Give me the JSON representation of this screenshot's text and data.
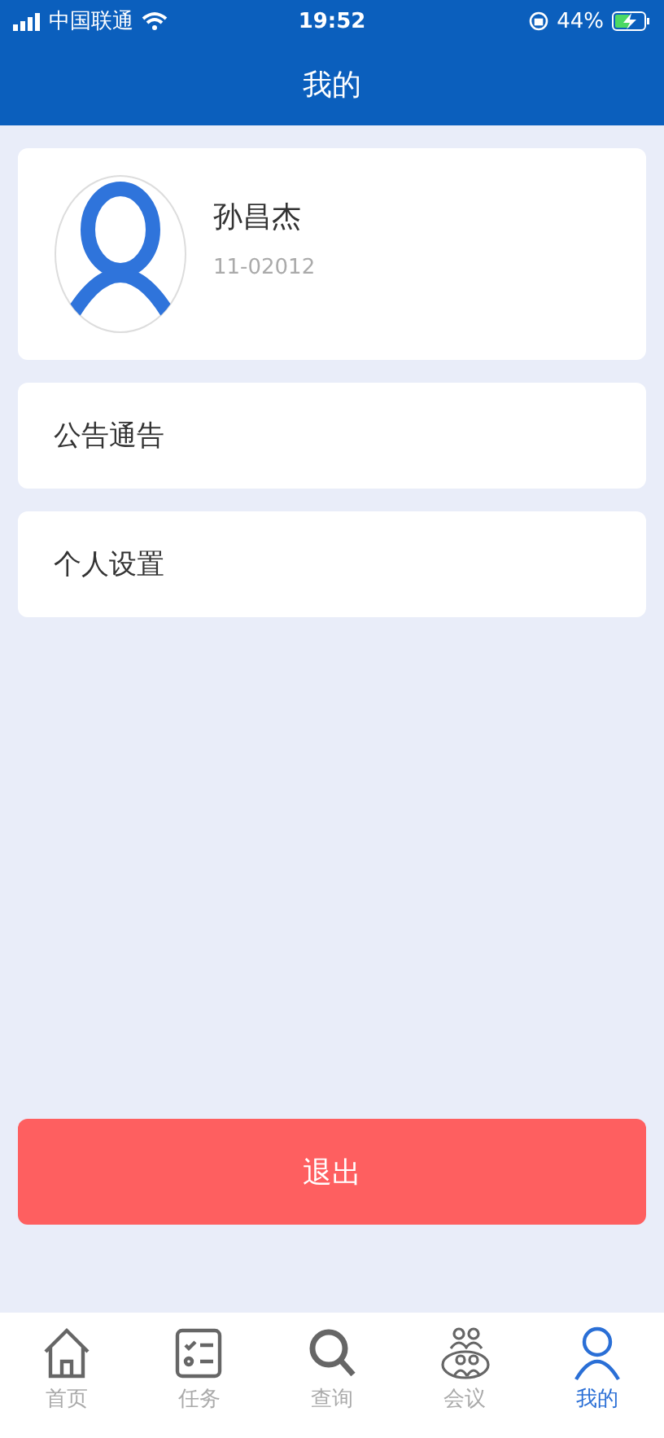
{
  "status_bar": {
    "carrier": "中国联通",
    "time": "19:52",
    "battery": "44%"
  },
  "header": {
    "title": "我的"
  },
  "profile": {
    "name": "孙昌杰",
    "id": "11-02012"
  },
  "menu": [
    {
      "label": "公告通告"
    },
    {
      "label": "个人设置"
    }
  ],
  "logout": {
    "label": "退出"
  },
  "tabs": [
    {
      "kind": "home",
      "label": "首页",
      "selected": false
    },
    {
      "kind": "tasks",
      "label": "任务",
      "selected": false
    },
    {
      "kind": "search",
      "label": "查询",
      "selected": false
    },
    {
      "kind": "meeting",
      "label": "会议",
      "selected": false
    },
    {
      "kind": "user",
      "label": "我的",
      "selected": true
    }
  ]
}
